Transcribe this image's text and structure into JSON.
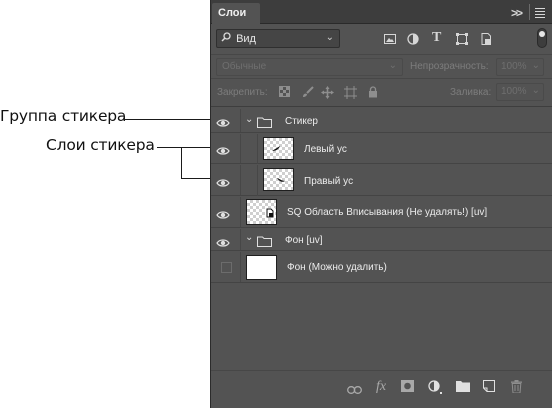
{
  "annotations": {
    "group_label": "Группа стикера",
    "layers_label": "Слои стикера"
  },
  "panel": {
    "tab": "Слои",
    "filter_kind": "Вид",
    "filter_icons": [
      "image-filter-icon",
      "adjustment-filter-icon",
      "type-filter-icon",
      "shape-filter-icon",
      "smart-object-filter-icon"
    ],
    "blend_mode": "Обычные",
    "opacity_label": "Непрозрачность:",
    "opacity_value": "100%",
    "lock_label": "Закрепить:",
    "lock_icons": [
      "lock-transparent-icon",
      "lock-image-icon",
      "lock-position-icon",
      "lock-artboard-icon",
      "lock-all-icon"
    ],
    "fill_label": "Заливка:",
    "fill_value": "100%"
  },
  "layers": [
    {
      "name": "Стикер",
      "type": "group",
      "visible": true,
      "expanded": true
    },
    {
      "name": "Левый ус",
      "type": "layer",
      "visible": true,
      "indent": 1
    },
    {
      "name": "Правый ус",
      "type": "layer",
      "visible": true,
      "indent": 1
    },
    {
      "name": "SQ Область Вписывания (Не удалять!) [uv]",
      "type": "smart-object",
      "visible": true
    },
    {
      "name": "Фон [uv]",
      "type": "group",
      "visible": true,
      "expanded": true
    },
    {
      "name": "Фон (Можно удалить)",
      "type": "layer",
      "visible": false,
      "fill": "#ffffff"
    }
  ],
  "bottom_icons": [
    "link-layers-icon",
    "fx-icon",
    "add-mask-icon",
    "adjustment-layer-icon",
    "new-group-icon",
    "new-layer-icon",
    "delete-icon"
  ],
  "colors": {
    "panel_bg": "#535353",
    "tabbar_bg": "#3d3d3d",
    "text": "#ececec",
    "disabled_text": "#6f6f6f"
  }
}
